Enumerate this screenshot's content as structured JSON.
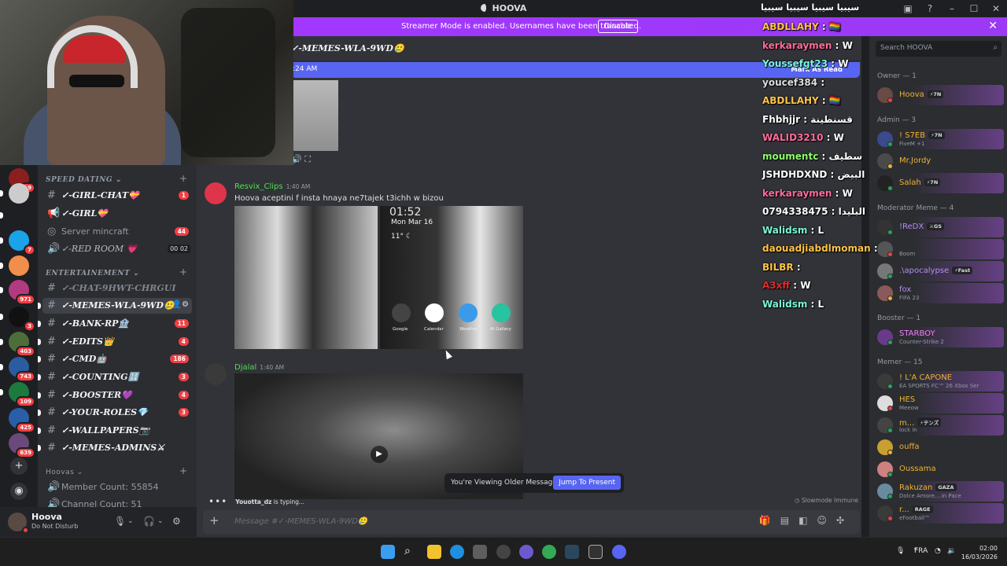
{
  "window": {
    "title": "HOOVA"
  },
  "banner": {
    "text": "Streamer Mode is enabled. Usernames have been truncated.",
    "disable_label": "Disable"
  },
  "overlay_header": "سيبيا سيبيا سيبيا سيبيا",
  "overlay_chat": [
    {
      "user": "ABDLLAHY",
      "msg": "🏳️‍🌈",
      "color": "#ffc447"
    },
    {
      "user": "kerkaraymen",
      "msg": "W",
      "color": "#ff6b9a"
    },
    {
      "user": "Youssefgt23",
      "msg": "W",
      "color": "#7cf5d8"
    },
    {
      "user": "youcef384",
      "msg": "",
      "color": "#dbdee1"
    },
    {
      "user": "ABDLLAHY",
      "msg": "🏳️‍🌈",
      "color": "#ffc447"
    },
    {
      "user": "Fhbhjjr",
      "msg": "قسنطينة",
      "color": "#ffffff"
    },
    {
      "user": "WALID3210",
      "msg": "W",
      "color": "#ff6b9a"
    },
    {
      "user": "moumentc",
      "msg": "سطيف",
      "color": "#8dff6b"
    },
    {
      "user": "JSHDHDXND",
      "msg": "البيض",
      "color": "#ffffff"
    },
    {
      "user": "kerkaraymen",
      "msg": "W",
      "color": "#ff6b9a"
    },
    {
      "user": "0794338475",
      "msg": "البليدا",
      "color": "#ffffff"
    },
    {
      "user": "Walidsm",
      "msg": "L",
      "color": "#7cf5d8"
    },
    {
      "user": "daouadjiabdlmoman",
      "msg": "",
      "color": "#ffc447"
    },
    {
      "user": "BILBR",
      "msg": "",
      "color": "#ffc447"
    },
    {
      "user": "A3xff",
      "msg": "W",
      "color": "#e02b2b"
    },
    {
      "user": "Walidsm",
      "msg": "L",
      "color": "#7cf5d8"
    }
  ],
  "servers": [
    {
      "badge": "19",
      "color": "#8b1e1e"
    },
    {
      "badge": "",
      "color": "#ccc"
    },
    {
      "badge": "",
      "color": "#1e1f22"
    },
    {
      "badge": "7",
      "color": "#1aa3e8"
    },
    {
      "badge": "",
      "color": "#f28e4b"
    },
    {
      "badge": "971",
      "color": "#b23a7e"
    },
    {
      "badge": "3",
      "color": "#111"
    },
    {
      "badge": "403",
      "color": "#4d6e3a"
    },
    {
      "badge": "743",
      "color": "#2b5ba0"
    },
    {
      "badge": "109",
      "color": "#1d7a3e"
    },
    {
      "badge": "425",
      "color": "#2a5fa8"
    },
    {
      "badge": "639",
      "color": "#6a4a7a"
    }
  ],
  "channels": {
    "categories": [
      {
        "name": "SPEED DATING"
      },
      {
        "name": "ENTERTAINEMENT"
      },
      {
        "name": "Hoovas"
      }
    ],
    "items": [
      {
        "name": "✓-GIRL-CHAT💝",
        "count": "1"
      },
      {
        "name": "✓-GIRL💝",
        "count": ""
      },
      {
        "name": "Server mincraft",
        "count": "44"
      },
      {
        "name": "✓-RED ROOM 💗",
        "count": "",
        "vc1": "00",
        "vc2": "02"
      },
      {
        "name": "✓-CHAT-9HWT-CHRGUI",
        "count": ""
      },
      {
        "name": "✓-MEMES-WLA-9WD🥲",
        "count": ""
      },
      {
        "name": "✓-BANK-RP🏦",
        "count": "11"
      },
      {
        "name": "✓-EDITS👑",
        "count": "4"
      },
      {
        "name": "✓-CMD🤖",
        "count": "186"
      },
      {
        "name": "✓-COUNTING🔢",
        "count": "3"
      },
      {
        "name": "✓-BOOSTER💜",
        "count": "4"
      },
      {
        "name": "✓-YOUR-ROLES💎",
        "count": "3"
      },
      {
        "name": "✓-WALLPAPERS📷",
        "count": ""
      },
      {
        "name": "✓-MEMES-ADMINS⚔",
        "count": ""
      },
      {
        "name": "Member Count: 55854",
        "count": ""
      },
      {
        "name": "Channel Count: 51",
        "count": ""
      }
    ]
  },
  "user": {
    "name": "Hoova",
    "status": "Do Not Disturb"
  },
  "chat": {
    "channel": "✓-MEMES-WLA-9WD🥲",
    "new_bar_time": ":24 AM",
    "mark_read": "Mark As Read",
    "messages": [
      {
        "author": "Resvix_Clips",
        "time": "1:40 AM",
        "text": "Hoova aceptini f insta hnaya ne7tajek t3ichh w bizou",
        "color": "#4ee04e"
      },
      {
        "author": "Djalal",
        "time": "1:40 AM",
        "text": "",
        "color": "#4ee04e"
      }
    ],
    "phone": {
      "clock": "01:52",
      "date": "Mon Mar 16",
      "temp": "11° ☾",
      "apps": [
        "Google",
        "Calendar",
        "Weather",
        "AI Gallery"
      ]
    },
    "jump": {
      "text": "You're Viewing Older Messages",
      "button": "Jump To Present"
    },
    "typing_user": "Youotta_dz",
    "typing_suffix": " is typing...",
    "slowmode": "Slowmode Immune",
    "placeholder": "Message #✓-MEMES-WLA-9WD🥲"
  },
  "members": {
    "search_placeholder": "Search HOOVA",
    "groups": [
      {
        "title": "Owner — 1",
        "members": [
          {
            "name": "Hoova",
            "tag": "⚡7N",
            "activity": "",
            "color": "#f0b232"
          }
        ]
      },
      {
        "title": "Admin — 3",
        "members": [
          {
            "name": "! S7EB",
            "tag": "⚡7N",
            "activity": "FiveM +1",
            "color": "#f0b232"
          },
          {
            "name": "Mr.Jordy",
            "tag": "",
            "activity": "",
            "color": "#f0b232"
          },
          {
            "name": "Salah",
            "tag": "⚡7N",
            "activity": "",
            "color": "#f0b232"
          }
        ]
      },
      {
        "title": "Moderator Meme — 4",
        "members": [
          {
            "name": "!ReDX",
            "tag": "⚔GS",
            "activity": "",
            "color": "#b48df2"
          },
          {
            "name": "",
            "tag": "",
            "activity": "Boom",
            "color": "#b48df2"
          },
          {
            "name": ".\\apocalypse",
            "tag": "⚡Fast",
            "activity": "",
            "color": "#b48df2"
          },
          {
            "name": "fox",
            "tag": "",
            "activity": "FIFA 23",
            "color": "#b48df2"
          }
        ]
      },
      {
        "title": "Booster — 1",
        "members": [
          {
            "name": "STARBOY",
            "tag": "",
            "activity": "Counter-Strike 2",
            "color": "#f47fff"
          }
        ]
      },
      {
        "title": "Memer — 15",
        "members": [
          {
            "name": "! L'A CAPONE",
            "tag": "",
            "activity": "EA SPORTS FC™ 26 Xbox Ser",
            "color": "#f0b232"
          },
          {
            "name": "HES",
            "tag": "",
            "activity": "Meeow",
            "color": "#f0b232"
          },
          {
            "name": "m...",
            "tag": "⚡テンズ",
            "activity": "lock in",
            "color": "#f0b232"
          },
          {
            "name": "ouffa",
            "tag": "",
            "activity": "",
            "color": "#f0b232"
          },
          {
            "name": "Oussama",
            "tag": "",
            "activity": "",
            "color": "#f0b232"
          },
          {
            "name": "Rakuzan",
            "tag": "GAZA",
            "activity": "Dolce Amore....in Pace",
            "color": "#f0b232"
          },
          {
            "name": "r...",
            "tag": "RAGE",
            "activity": "eFootball™",
            "color": "#f0b232"
          }
        ]
      }
    ]
  },
  "taskbar": {
    "lang": "FRA",
    "time": "02:00",
    "date": "16/03/2026"
  }
}
